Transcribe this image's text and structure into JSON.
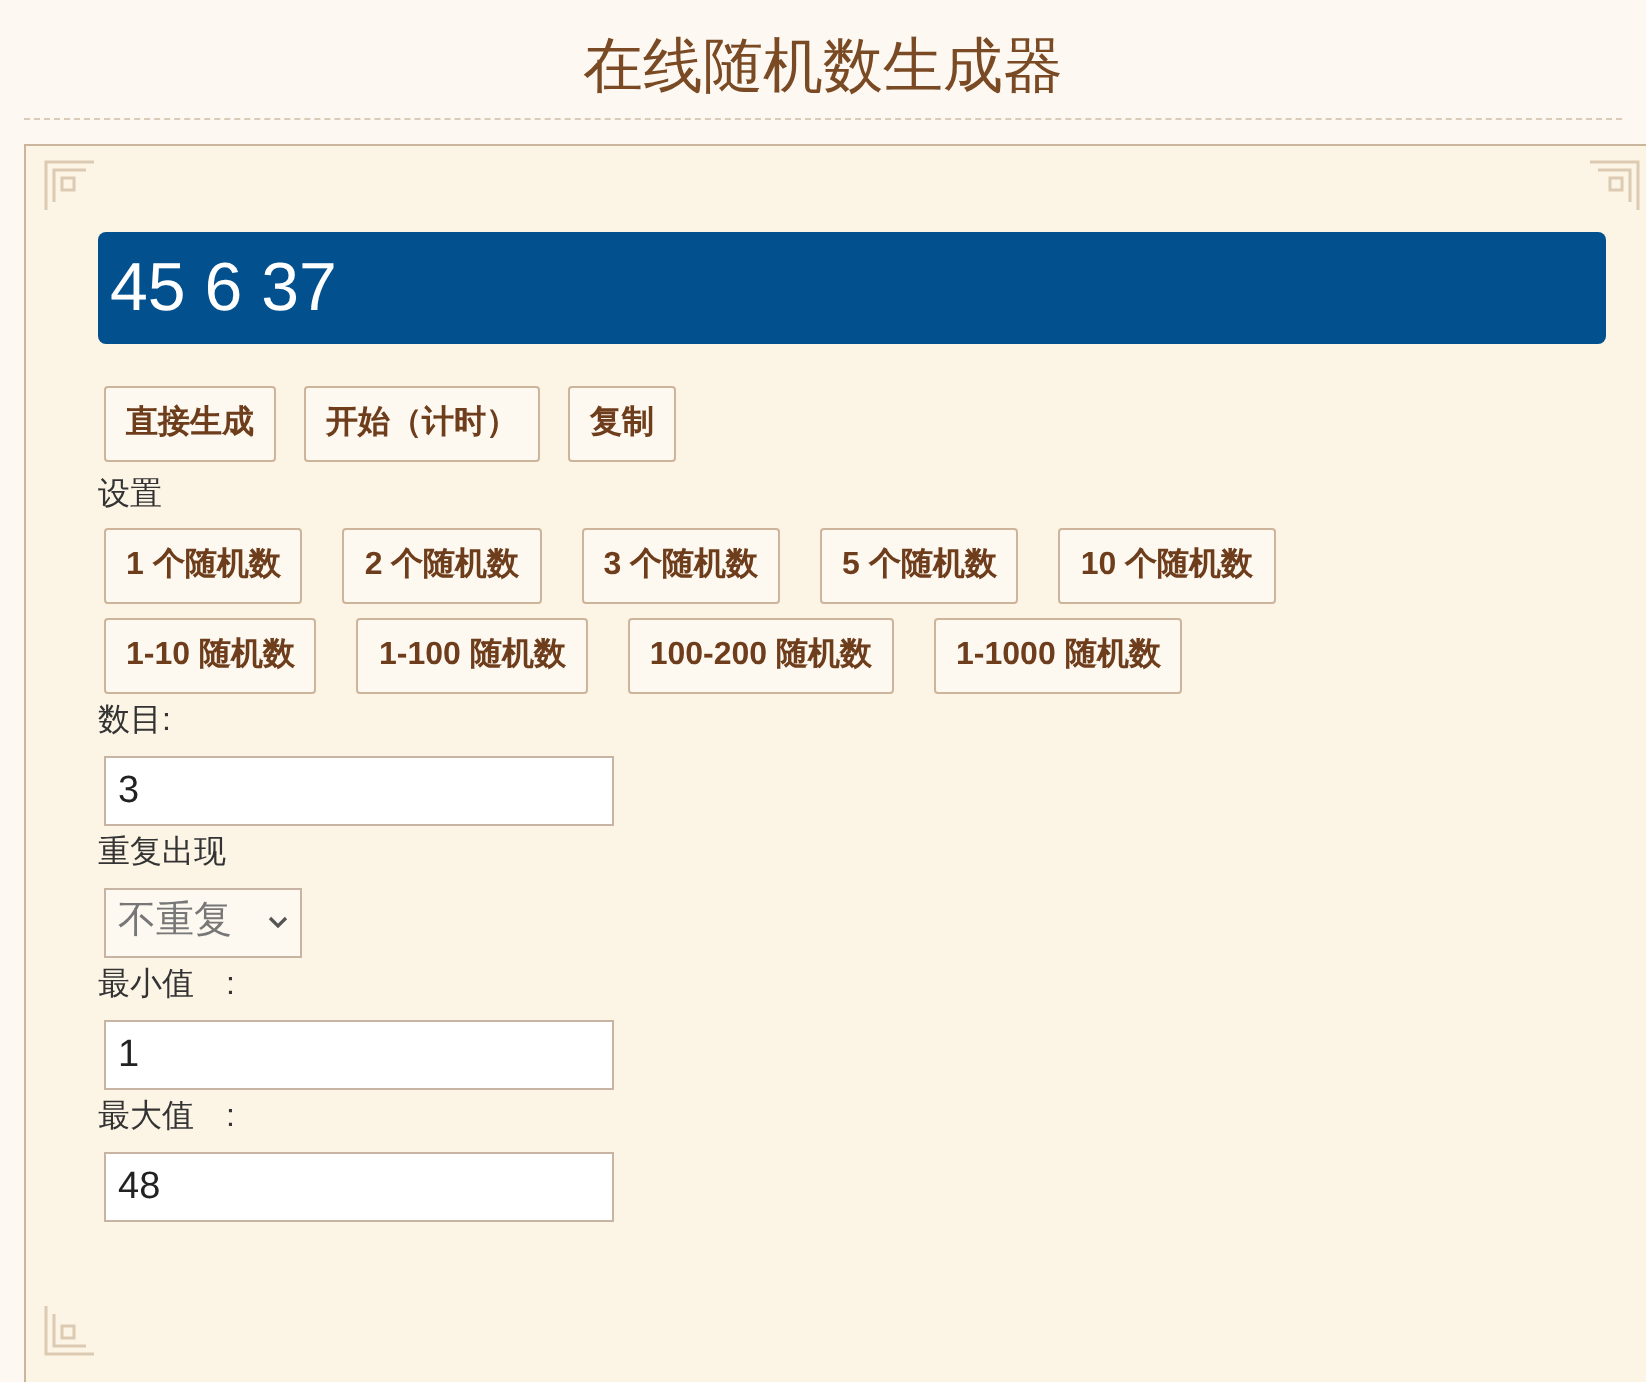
{
  "title": "在线随机数生成器",
  "result": "45 6 37",
  "actions": [
    "直接生成",
    "开始（计时）",
    "复制"
  ],
  "settings_label": "设置",
  "presets": [
    [
      "1 个随机数",
      "2 个随机数",
      "3 个随机数",
      "5 个随机数",
      "10 个随机数"
    ],
    [
      "1-10 随机数",
      "1-100 随机数",
      "100-200 随机数",
      "1-1000 随机数"
    ]
  ],
  "fields": [
    {
      "kind": "input",
      "label": "数目:",
      "value": "3"
    },
    {
      "kind": "select",
      "label": "重复出现",
      "value": "不重复"
    },
    {
      "kind": "input",
      "label": "最小值　:",
      "value": "1"
    },
    {
      "kind": "input",
      "label": "最大值　:",
      "value": "48"
    }
  ]
}
